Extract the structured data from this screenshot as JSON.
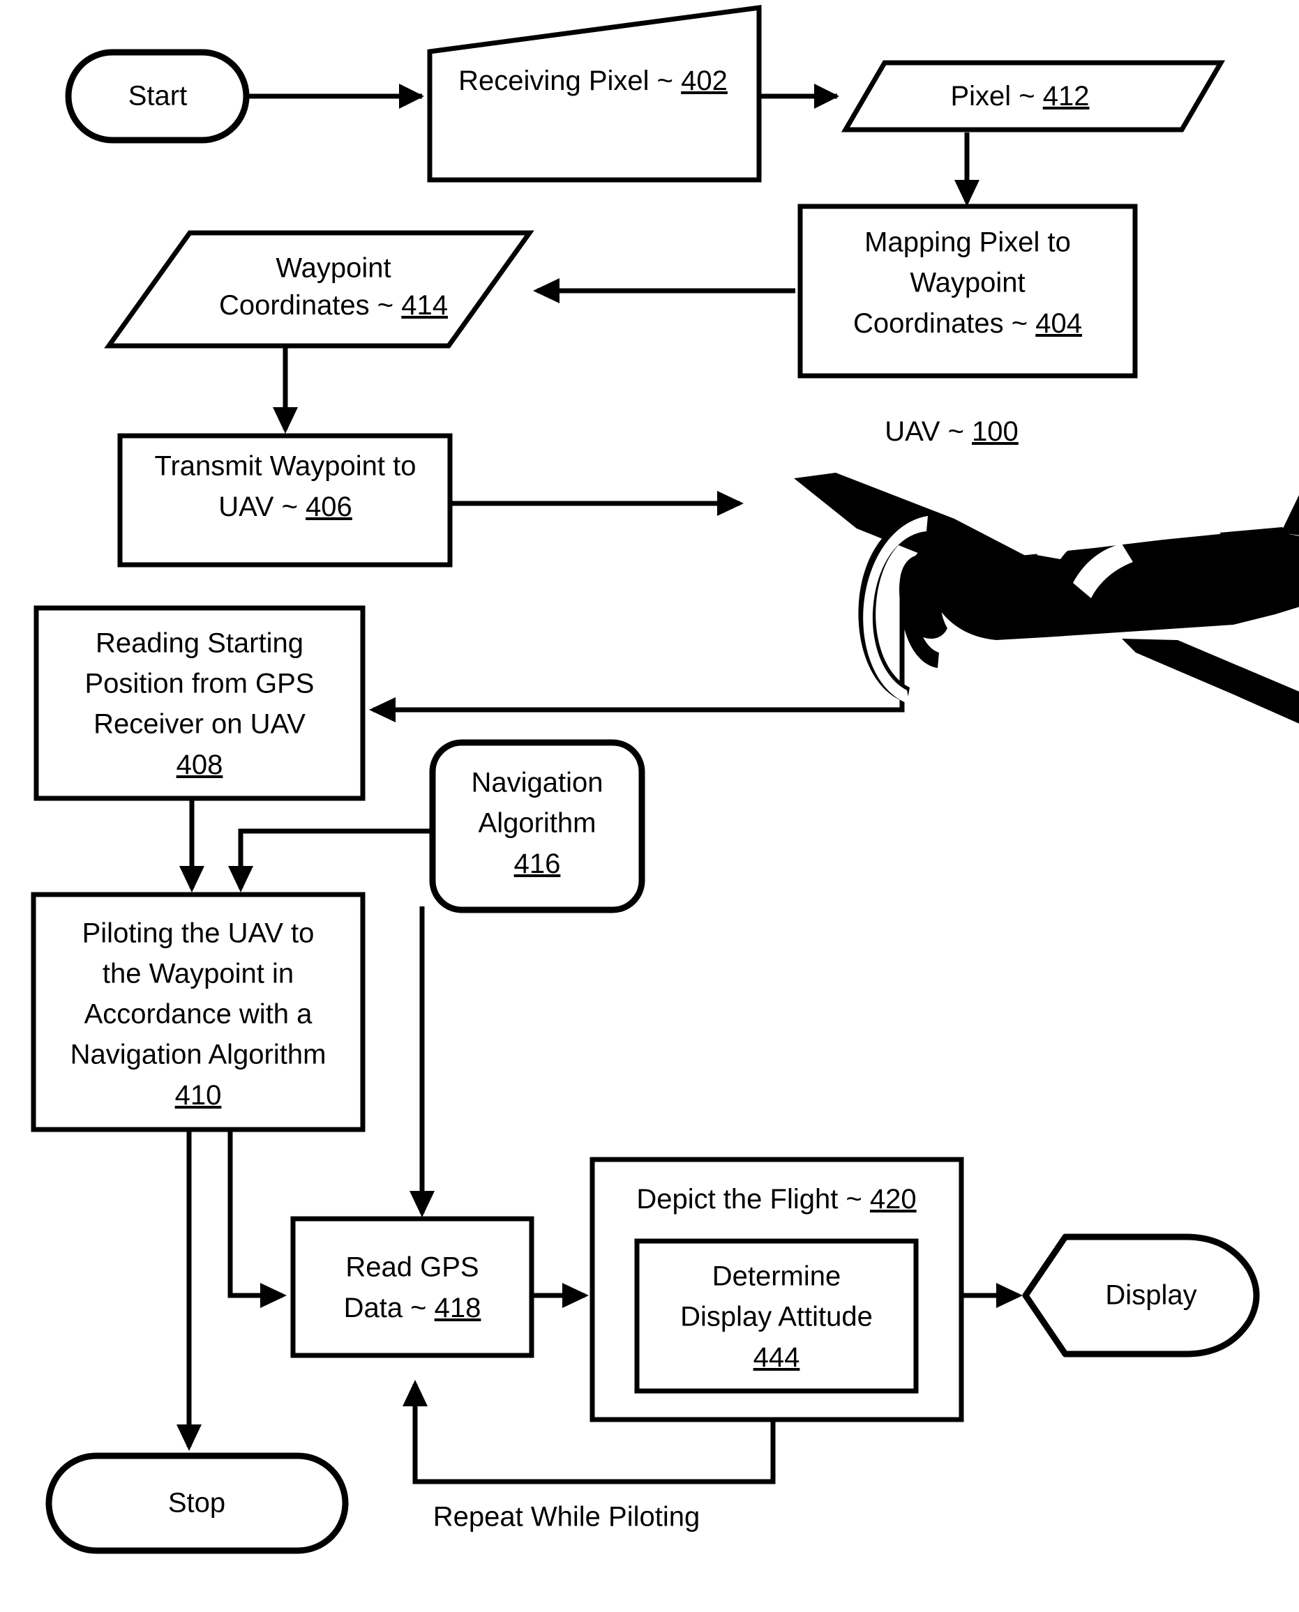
{
  "figure": {
    "type": "patent-flowchart",
    "title_absent": true
  },
  "nodes": {
    "start": {
      "label": "Start",
      "shape": "terminator"
    },
    "receiving_pixel": {
      "line1": "Receiving Pixel ~ ",
      "ref": "402",
      "shape": "skewed-process"
    },
    "pixel_data": {
      "line1": "Pixel ~ ",
      "ref": "412",
      "shape": "parallelogram-data"
    },
    "mapping": {
      "line1": "Mapping Pixel  to",
      "line2": "Waypoint",
      "line3": "Coordinates ~ ",
      "ref": "404",
      "shape": "process"
    },
    "waypoint_coords": {
      "line1": "Waypoint",
      "line2": "Coordinates ~ ",
      "ref": "414",
      "shape": "parallelogram-data"
    },
    "transmit": {
      "line1": "Transmit Waypoint to",
      "line2": "UAV ~ ",
      "ref": "406",
      "shape": "process"
    },
    "uav": {
      "label": "UAV  ~ ",
      "ref": "100",
      "shape": "illustration-airplane"
    },
    "reading_start": {
      "line1": "Reading Starting",
      "line2": "Position from GPS",
      "line3": "Receiver on UAV",
      "ref": "408",
      "shape": "process"
    },
    "nav_algorithm": {
      "line1": "Navigation",
      "line2": "Algorithm",
      "ref": "416",
      "shape": "rounded-process"
    },
    "piloting": {
      "line1": "Piloting the UAV to",
      "line2": "the Waypoint in",
      "line3": "Accordance with a",
      "line4": "Navigation Algorithm",
      "ref": "410",
      "shape": "process"
    },
    "read_gps": {
      "line1": "Read GPS",
      "line2": "Data ~ ",
      "ref": "418",
      "shape": "process"
    },
    "depict_flight": {
      "line1": "Depict the Flight ~ ",
      "ref": "420",
      "shape": "process-container"
    },
    "determine_attitude": {
      "line1": "Determine",
      "line2": "Display Attitude",
      "ref": "444",
      "shape": "process"
    },
    "display": {
      "label": "Display",
      "shape": "display-symbol"
    },
    "stop": {
      "label": "Stop",
      "shape": "terminator"
    }
  },
  "edges": {
    "repeat_label": "Repeat While Piloting"
  },
  "colors": {
    "stroke": "#000000",
    "fill": "#ffffff",
    "text": "#000000"
  }
}
